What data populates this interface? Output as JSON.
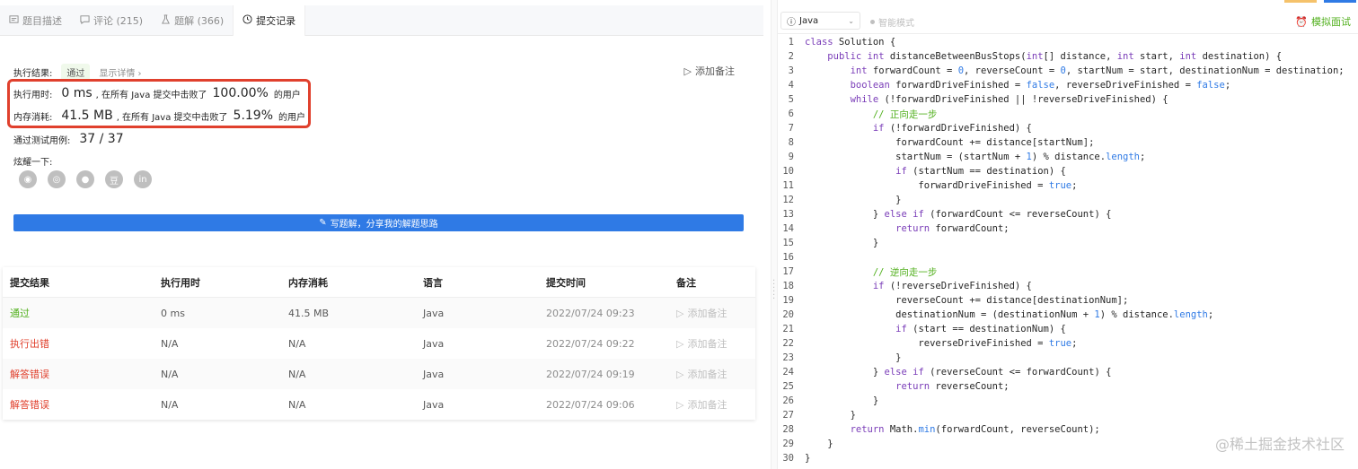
{
  "tabs": [
    {
      "label": "题目描述",
      "icon": "description-icon"
    },
    {
      "label": "评论 (215)",
      "icon": "comment-icon"
    },
    {
      "label": "题解 (366)",
      "icon": "solution-icon"
    },
    {
      "label": "提交记录",
      "icon": "clock-icon"
    }
  ],
  "result": {
    "label": "执行结果:",
    "status": "通过",
    "details": "显示详情 ›",
    "add_note": "添加备注"
  },
  "runtime": {
    "label": "执行用时:",
    "value": "0 ms",
    "beat_text": ", 在所有 Java 提交中击败了",
    "percent": "100.00%",
    "users": "的用户"
  },
  "memory": {
    "label": "内存消耗:",
    "value": "41.5 MB",
    "beat_text": ", 在所有 Java 提交中击败了",
    "percent": "5.19%",
    "users": "的用户"
  },
  "testcases": {
    "label": "通过测试用例:",
    "value": "37 / 37"
  },
  "share": {
    "label": "炫耀一下:",
    "icons": [
      "wechat-icon",
      "weibo-icon",
      "qq-icon",
      "douban-icon",
      "linkedin-icon"
    ]
  },
  "write_solution": "写题解，分享我的解题思路",
  "table": {
    "headers": [
      "提交结果",
      "执行用时",
      "内存消耗",
      "语言",
      "提交时间",
      "备注"
    ],
    "rows": [
      {
        "status": "通过",
        "ok": true,
        "time": "0 ms",
        "mem": "41.5 MB",
        "lang": "Java",
        "date": "2022/07/24 09:23",
        "note": "添加备注"
      },
      {
        "status": "执行出错",
        "ok": false,
        "time": "N/A",
        "mem": "N/A",
        "lang": "Java",
        "date": "2022/07/24 09:22",
        "note": "添加备注"
      },
      {
        "status": "解答错误",
        "ok": false,
        "time": "N/A",
        "mem": "N/A",
        "lang": "Java",
        "date": "2022/07/24 09:19",
        "note": "添加备注"
      },
      {
        "status": "解答错误",
        "ok": false,
        "time": "N/A",
        "mem": "N/A",
        "lang": "Java",
        "date": "2022/07/24 09:06",
        "note": "添加备注"
      }
    ]
  },
  "editor": {
    "language": "Java",
    "smart_mode": "智能模式",
    "mock": "模拟面试",
    "watermark": "@稀土掘金技术社区",
    "code": [
      "class Solution {",
      "    public int distanceBetweenBusStops(int[] distance, int start, int destination) {",
      "        int forwardCount = 0, reverseCount = 0, startNum = start, destinationNum = destination;",
      "        boolean forwardDriveFinished = false, reverseDriveFinished = false;",
      "        while (!forwardDriveFinished || !reverseDriveFinished) {",
      "            // 正向走一步",
      "            if (!forwardDriveFinished) {",
      "                forwardCount += distance[startNum];",
      "                startNum = (startNum + 1) % distance.length;",
      "                if (startNum == destination) {",
      "                    forwardDriveFinished = true;",
      "                }",
      "            } else if (forwardCount <= reverseCount) {",
      "                return forwardCount;",
      "            }",
      "",
      "            // 逆向走一步",
      "            if (!reverseDriveFinished) {",
      "                reverseCount += distance[destinationNum];",
      "                destinationNum = (destinationNum + 1) % distance.length;",
      "                if (start == destinationNum) {",
      "                    reverseDriveFinished = true;",
      "                }",
      "            } else if (reverseCount <= forwardCount) {",
      "                return reverseCount;",
      "            }",
      "        }",
      "        return Math.min(forwardCount, reverseCount);",
      "    }",
      "}"
    ]
  }
}
